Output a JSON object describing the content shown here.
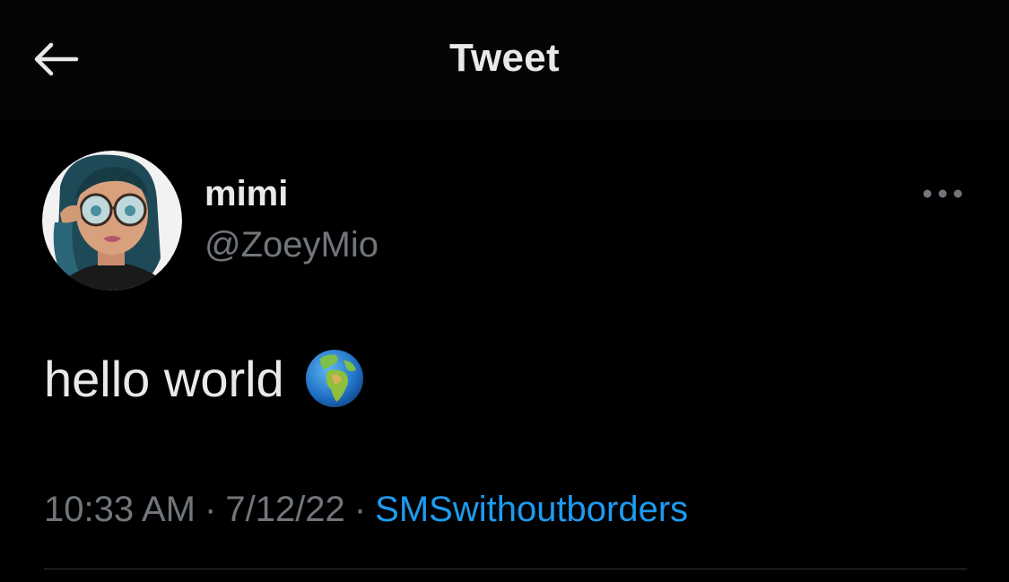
{
  "header": {
    "title": "Tweet",
    "back_icon": "arrow-left-icon"
  },
  "author": {
    "display_name": "mimi",
    "handle": "@ZoeyMio",
    "avatar": "avatar-illustration"
  },
  "more_icon": "more-horizontal-icon",
  "tweet": {
    "text": "hello world",
    "emoji": "globe-europe-africa-icon"
  },
  "meta": {
    "time": "10:33 AM",
    "separator": "·",
    "date": "7/12/22",
    "source": "SMSwithoutborders"
  },
  "colors": {
    "background": "#000000",
    "text": "#e7e9ea",
    "secondary": "#71767b",
    "link": "#1d9bf0",
    "divider": "#2f3336"
  }
}
